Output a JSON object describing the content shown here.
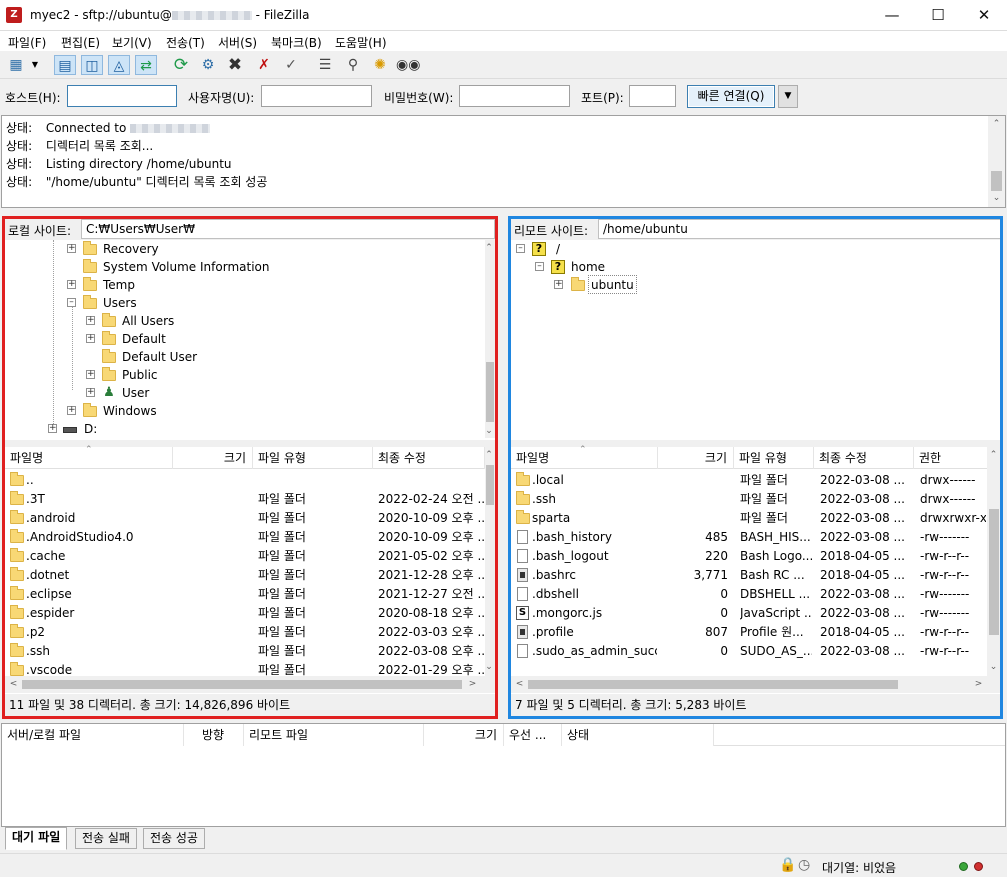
{
  "window": {
    "title": "myec2 - sftp://ubuntu@",
    "title_suffix": " - FileZilla",
    "app_icon": "filezilla-icon"
  },
  "menu": [
    "파일(F)",
    "편집(E)",
    "보기(V)",
    "전송(T)",
    "서버(S)",
    "북마크(B)",
    "도움말(H)"
  ],
  "quickconnect": {
    "host_label": "호스트(H):",
    "host_value": "",
    "user_label": "사용자명(U):",
    "user_value": "",
    "pass_label": "비밀번호(W):",
    "pass_value": "",
    "port_label": "포트(P):",
    "port_value": "",
    "connect_button": "빠른 연결(Q)"
  },
  "log": [
    {
      "key": "상태:",
      "msg": "Connected to"
    },
    {
      "key": "상태:",
      "msg": "디렉터리 목록 조회..."
    },
    {
      "key": "상태:",
      "msg": "Listing directory /home/ubuntu"
    },
    {
      "key": "상태:",
      "msg": "\"/home/ubuntu\" 디렉터리 목록 조회 성공"
    }
  ],
  "local": {
    "path_label": "로컬 사이트:",
    "path": "C:₩Users₩User₩",
    "tree": [
      "Recovery",
      "System Volume Information",
      "Temp",
      "Users",
      "All Users",
      "Default",
      "Default User",
      "Public",
      "User",
      "Windows",
      "D:"
    ],
    "columns": [
      "파일명",
      "크기",
      "파일 유형",
      "최종 수정"
    ],
    "files": [
      {
        "name": "..",
        "size": "",
        "type": "",
        "modified": ""
      },
      {
        "name": ".3T",
        "size": "",
        "type": "파일 폴더",
        "modified": "2022-02-24 오전 ..."
      },
      {
        "name": ".android",
        "size": "",
        "type": "파일 폴더",
        "modified": "2020-10-09 오후 ..."
      },
      {
        "name": ".AndroidStudio4.0",
        "size": "",
        "type": "파일 폴더",
        "modified": "2020-10-09 오후 ..."
      },
      {
        "name": ".cache",
        "size": "",
        "type": "파일 폴더",
        "modified": "2021-05-02 오후 ..."
      },
      {
        "name": ".dotnet",
        "size": "",
        "type": "파일 폴더",
        "modified": "2021-12-28 오후 ..."
      },
      {
        "name": ".eclipse",
        "size": "",
        "type": "파일 폴더",
        "modified": "2021-12-27 오전 ..."
      },
      {
        "name": ".espider",
        "size": "",
        "type": "파일 폴더",
        "modified": "2020-08-18 오후 ..."
      },
      {
        "name": ".p2",
        "size": "",
        "type": "파일 폴더",
        "modified": "2022-03-03 오후 ..."
      },
      {
        "name": ".ssh",
        "size": "",
        "type": "파일 폴더",
        "modified": "2022-03-08 오후 ..."
      },
      {
        "name": ".vscode",
        "size": "",
        "type": "파일 폴더",
        "modified": "2022-01-29 오후 ..."
      }
    ],
    "status": "11 파일 및 38 디렉터리. 총 크기: 14,826,896 바이트"
  },
  "remote": {
    "path_label": "리모트 사이트:",
    "path": "/home/ubuntu",
    "tree": [
      "/",
      "home",
      "ubuntu"
    ],
    "columns": [
      "파일명",
      "크기",
      "파일 유형",
      "최종 수정",
      "권한"
    ],
    "files": [
      {
        "name": ".local",
        "size": "",
        "type": "파일 폴더",
        "modified": "2022-03-08 ...",
        "perm": "drwx------",
        "icon": "folder"
      },
      {
        "name": ".ssh",
        "size": "",
        "type": "파일 폴더",
        "modified": "2022-03-08 ...",
        "perm": "drwx------",
        "icon": "folder"
      },
      {
        "name": "sparta",
        "size": "",
        "type": "파일 폴더",
        "modified": "2022-03-08 ...",
        "perm": "drwxrwxr-x",
        "icon": "folder"
      },
      {
        "name": ".bash_history",
        "size": "485",
        "type": "BASH_HIS...",
        "modified": "2022-03-08 ...",
        "perm": "-rw-------",
        "icon": "file"
      },
      {
        "name": ".bash_logout",
        "size": "220",
        "type": "Bash Logo...",
        "modified": "2018-04-05 ...",
        "perm": "-rw-r--r--",
        "icon": "file"
      },
      {
        "name": ".bashrc",
        "size": "3,771",
        "type": "Bash RC ...",
        "modified": "2018-04-05 ...",
        "perm": "-rw-r--r--",
        "icon": "dark"
      },
      {
        "name": ".dbshell",
        "size": "0",
        "type": "DBSHELL ...",
        "modified": "2022-03-08 ...",
        "perm": "-rw-------",
        "icon": "file"
      },
      {
        "name": ".mongorc.js",
        "size": "0",
        "type": "JavaScript ...",
        "modified": "2022-03-08 ...",
        "perm": "-rw-------",
        "icon": "js"
      },
      {
        "name": ".profile",
        "size": "807",
        "type": "Profile 원...",
        "modified": "2018-04-05 ...",
        "perm": "-rw-r--r--",
        "icon": "dark"
      },
      {
        "name": ".sudo_as_admin_succ...",
        "size": "0",
        "type": "SUDO_AS_...",
        "modified": "2022-03-08 ...",
        "perm": "-rw-r--r--",
        "icon": "file"
      }
    ],
    "status": "7 파일 및 5 디렉터리. 총 크기: 5,283 바이트"
  },
  "queue": {
    "columns": [
      "서버/로컬 파일",
      "방향",
      "리모트 파일",
      "크기",
      "우선 ...",
      "상태"
    ],
    "tabs": [
      "대기 파일",
      "전송 실패",
      "전송 성공"
    ]
  },
  "statusbar": {
    "queue": "대기열: 비었음"
  },
  "colors": {
    "highlight_local": "#e02020",
    "highlight_remote": "#1f86e0",
    "folder": "#f8d875"
  }
}
